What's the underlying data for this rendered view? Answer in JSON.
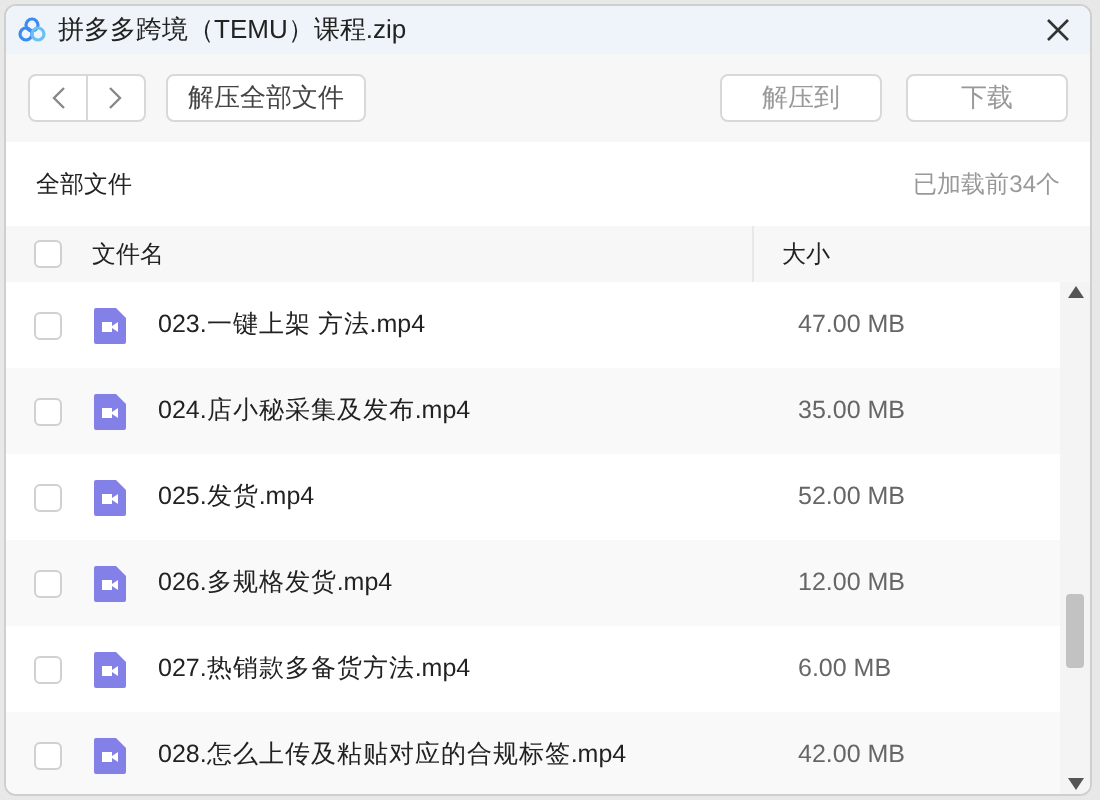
{
  "window": {
    "title": "拼多多跨境（TEMU）课程.zip"
  },
  "toolbar": {
    "extract_all": "解压全部文件",
    "extract_to": "解压到",
    "download": "下载"
  },
  "breadcrumb": "全部文件",
  "loaded_count": "已加载前34个",
  "table": {
    "select_all": {
      "checked": false
    },
    "columns": [
      "文件名",
      "大小"
    ],
    "rows": [
      {
        "name": "023.一键上架 方法.mp4",
        "size": "47.00 MB",
        "checked": false
      },
      {
        "name": "024.店小秘采集及发布.mp4",
        "size": "35.00 MB",
        "checked": false
      },
      {
        "name": "025.发货.mp4",
        "size": "52.00 MB",
        "checked": false
      },
      {
        "name": "026.多规格发货.mp4",
        "size": "12.00 MB",
        "checked": false
      },
      {
        "name": "027.热销款多备货方法.mp4",
        "size": "6.00 MB",
        "checked": false
      },
      {
        "name": "028.怎么上传及粘贴对应的合规标签.mp4",
        "size": "42.00 MB",
        "checked": false
      }
    ]
  }
}
